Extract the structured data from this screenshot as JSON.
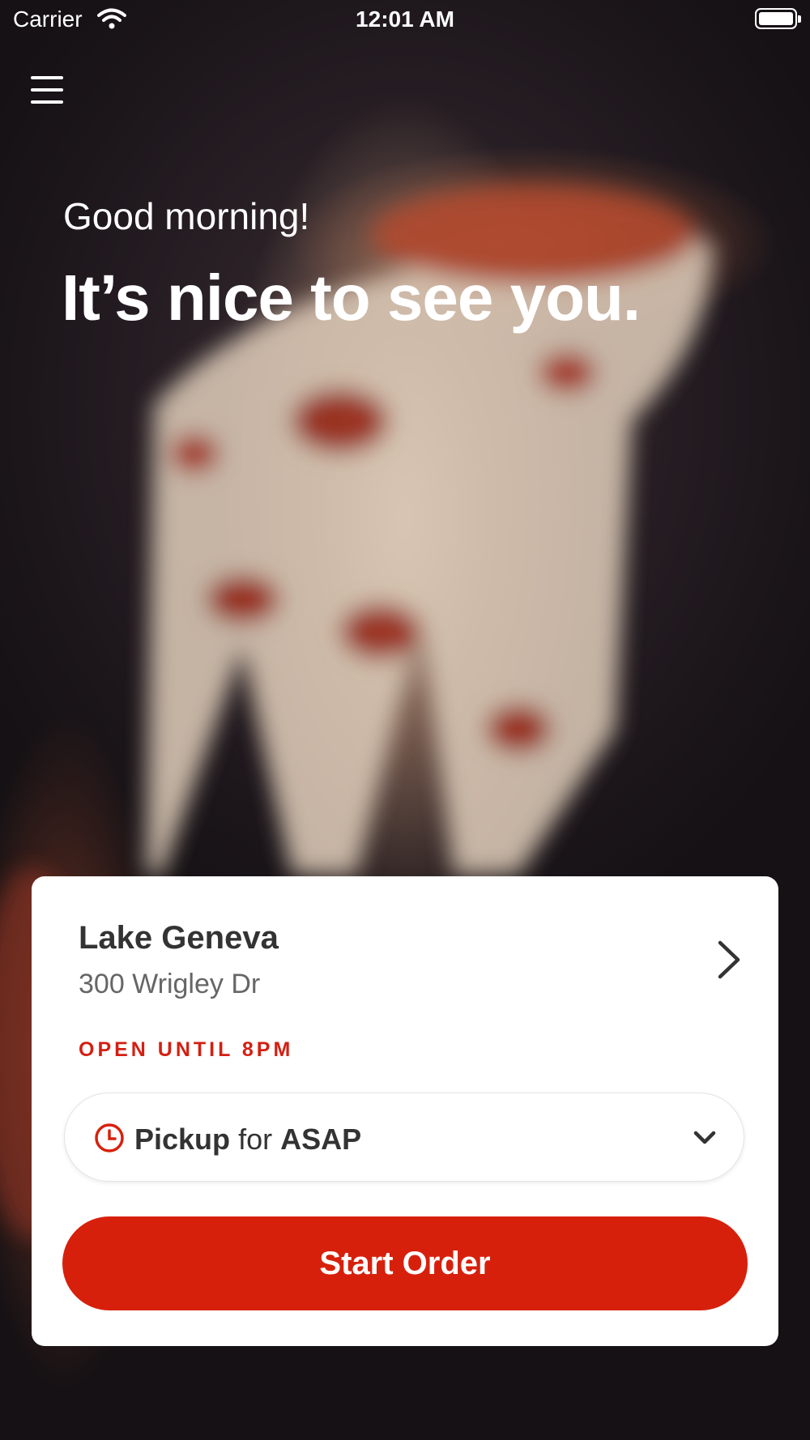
{
  "status_bar": {
    "carrier": "Carrier",
    "time": "12:01 AM"
  },
  "hero": {
    "greeting": "Good morning!",
    "headline": "It’s nice to see you."
  },
  "location": {
    "name": "Lake Geneva",
    "address": "300 Wrigley Dr",
    "status": "OPEN UNTIL 8PM"
  },
  "order_type": {
    "mode": "Pickup",
    "connector": "for",
    "time": "ASAP"
  },
  "actions": {
    "start_order": "Start Order"
  },
  "colors": {
    "accent": "#d7200c",
    "status_text": "#d41f12",
    "background": "#151114"
  },
  "icons": {
    "menu": "hamburger-menu-icon",
    "wifi": "wifi-icon",
    "battery": "battery-icon",
    "clock": "clock-icon",
    "location_chevron": "chevron-right-icon",
    "dropdown": "chevron-down-icon"
  }
}
